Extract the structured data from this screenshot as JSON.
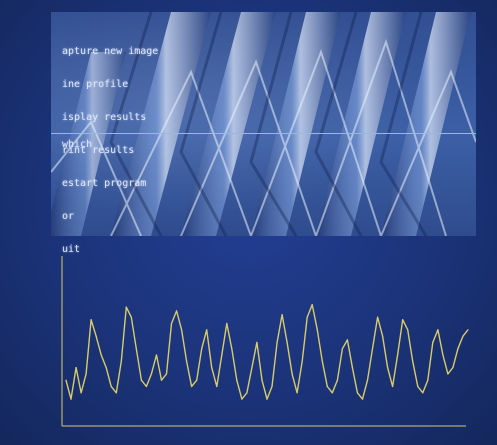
{
  "menu": {
    "items": [
      {
        "label": "apture new image"
      },
      {
        "label": "ine profile"
      },
      {
        "label": "isplay results"
      },
      {
        "label": "rint results"
      },
      {
        "label": "estart program"
      },
      {
        "label": "or"
      },
      {
        "label": "uit"
      }
    ],
    "text_color": "#dfe8ff"
  },
  "prompt": {
    "label": "which"
  },
  "chart_data": {
    "type": "line",
    "title": "",
    "xlabel": "",
    "ylabel": "",
    "grid": false,
    "color": "#d8cc6a",
    "x": [
      0,
      10,
      20,
      30,
      40,
      50,
      60,
      70,
      80,
      90,
      100,
      110,
      120,
      130,
      140,
      150,
      160,
      170,
      180,
      190,
      200,
      210,
      220,
      230,
      240,
      250,
      260,
      270,
      280,
      290,
      300,
      310,
      320,
      330,
      340,
      350,
      360,
      370,
      380,
      390,
      400,
      410,
      420,
      430,
      440,
      450,
      460,
      470,
      480,
      490,
      500,
      510,
      520,
      530,
      540,
      550,
      560,
      570,
      580,
      590,
      600,
      610,
      620,
      630,
      640,
      650,
      660,
      670,
      680,
      690,
      700,
      710,
      720,
      730,
      740,
      750,
      760,
      770,
      780,
      790,
      800
    ],
    "y": [
      0.3,
      0.15,
      0.4,
      0.2,
      0.35,
      0.78,
      0.65,
      0.5,
      0.4,
      0.25,
      0.2,
      0.45,
      0.88,
      0.8,
      0.55,
      0.3,
      0.25,
      0.35,
      0.5,
      0.3,
      0.35,
      0.75,
      0.85,
      0.7,
      0.45,
      0.25,
      0.3,
      0.55,
      0.7,
      0.4,
      0.25,
      0.5,
      0.75,
      0.55,
      0.3,
      0.15,
      0.2,
      0.4,
      0.6,
      0.3,
      0.15,
      0.25,
      0.6,
      0.82,
      0.6,
      0.35,
      0.2,
      0.45,
      0.8,
      0.9,
      0.7,
      0.45,
      0.25,
      0.2,
      0.3,
      0.55,
      0.62,
      0.4,
      0.2,
      0.15,
      0.3,
      0.55,
      0.8,
      0.65,
      0.4,
      0.25,
      0.5,
      0.78,
      0.7,
      0.45,
      0.25,
      0.2,
      0.3,
      0.6,
      0.7,
      0.5,
      0.35,
      0.4,
      0.55,
      0.65,
      0.7
    ],
    "ylim": [
      0,
      1
    ],
    "xlim": [
      0,
      800
    ]
  }
}
